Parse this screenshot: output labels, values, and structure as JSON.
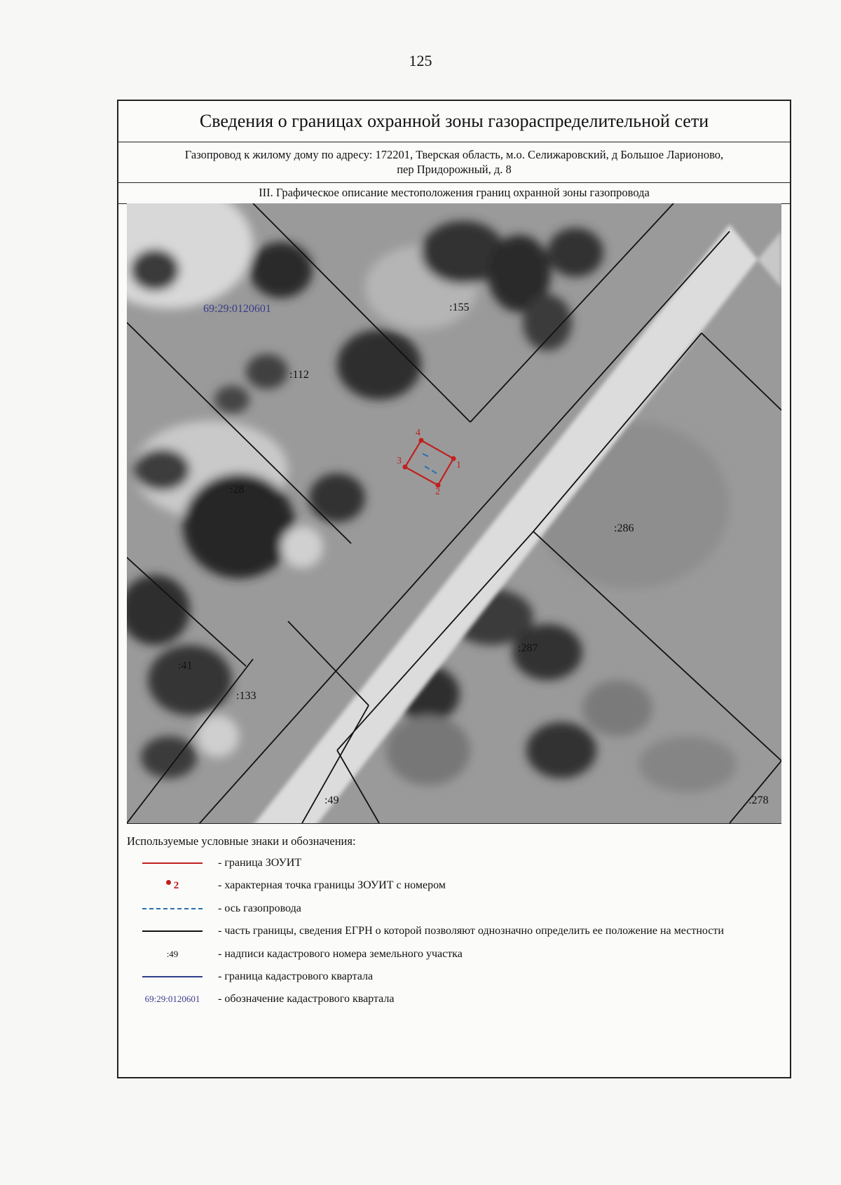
{
  "page_number": "125",
  "header": {
    "title": "Сведения о границах охранной зоны газораспределительной сети",
    "object_line1": "Газопровод к жилому дому по адресу: 172201, Тверская область, м.о. Селижаровский, д Большое Ларионово,",
    "object_line2": "пер Придорожный, д. 8",
    "section": "III. Графическое описание местоположения границ охранной зоны газопровода"
  },
  "map": {
    "quarter": "69:29:0120601",
    "parcels": [
      ":155",
      ":112",
      ":28",
      ":286",
      ":287",
      ":41",
      ":133",
      ":49",
      ":278"
    ],
    "points": [
      "1",
      "2",
      "3",
      "4"
    ]
  },
  "legend": {
    "title": "Используемые условные знаки и обозначения:",
    "items": [
      {
        "symbol": "red-line",
        "text": "- граница ЗОУИТ"
      },
      {
        "symbol": "point",
        "label": "2",
        "text": "- характерная точка границы ЗОУИТ с номером"
      },
      {
        "symbol": "blue-dash",
        "text": "- ось газопровода"
      },
      {
        "symbol": "black-line",
        "text": "- часть границы, сведения ЕГРН о которой позволяют однозначно определить ее положение на местности"
      },
      {
        "symbol": "parcel-label",
        "label": ":49",
        "text": "- надписи кадастрового номера земельного участка"
      },
      {
        "symbol": "navy-line",
        "text": "- граница кадастрового квартала"
      },
      {
        "symbol": "quarter-label",
        "label": "69:29:0120601",
        "text": "- обозначение кадастрового квартала"
      }
    ]
  },
  "colors": {
    "zone_boundary": "#c0201f",
    "gas_axis": "#2a6fb5",
    "quarter_boundary": "#2f3e8c",
    "quarter_label": "#3a3a8a"
  }
}
